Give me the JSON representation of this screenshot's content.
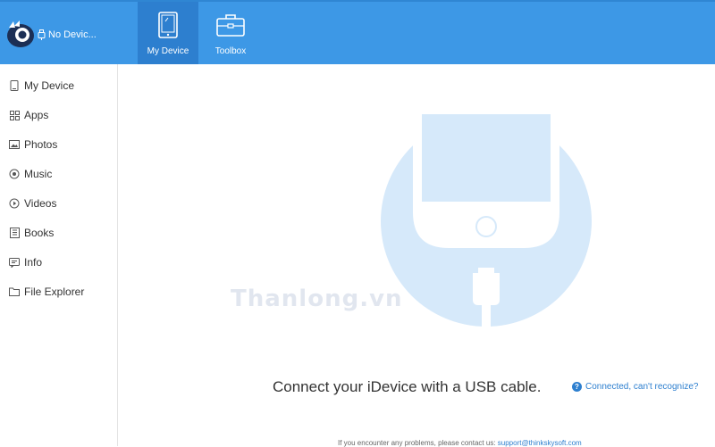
{
  "header": {
    "device_status": "No Devic...",
    "tabs": [
      {
        "label": "My Device",
        "icon": "tablet-icon",
        "active": true
      },
      {
        "label": "Toolbox",
        "icon": "toolbox-icon",
        "active": false
      }
    ]
  },
  "sidebar": {
    "items": [
      {
        "label": "My Device",
        "icon": "device-icon"
      },
      {
        "label": "Apps",
        "icon": "apps-grid-icon"
      },
      {
        "label": "Photos",
        "icon": "photo-icon"
      },
      {
        "label": "Music",
        "icon": "music-icon"
      },
      {
        "label": "Videos",
        "icon": "video-icon"
      },
      {
        "label": "Books",
        "icon": "book-icon"
      },
      {
        "label": "Info",
        "icon": "info-icon"
      },
      {
        "label": "File Explorer",
        "icon": "folder-icon"
      }
    ]
  },
  "main": {
    "watermark": "Thanlong.vn",
    "connect_message": "Connect your iDevice with a USB cable.",
    "help_link": "Connected, can't recognize?",
    "footer_text": "If you encounter any problems, please contact us: ",
    "footer_link": "support@thinkskysoft.com"
  },
  "colors": {
    "accent": "#3d98e6",
    "accent_dark": "#2d7fcf",
    "hero_circle": "#d6e9fa"
  }
}
